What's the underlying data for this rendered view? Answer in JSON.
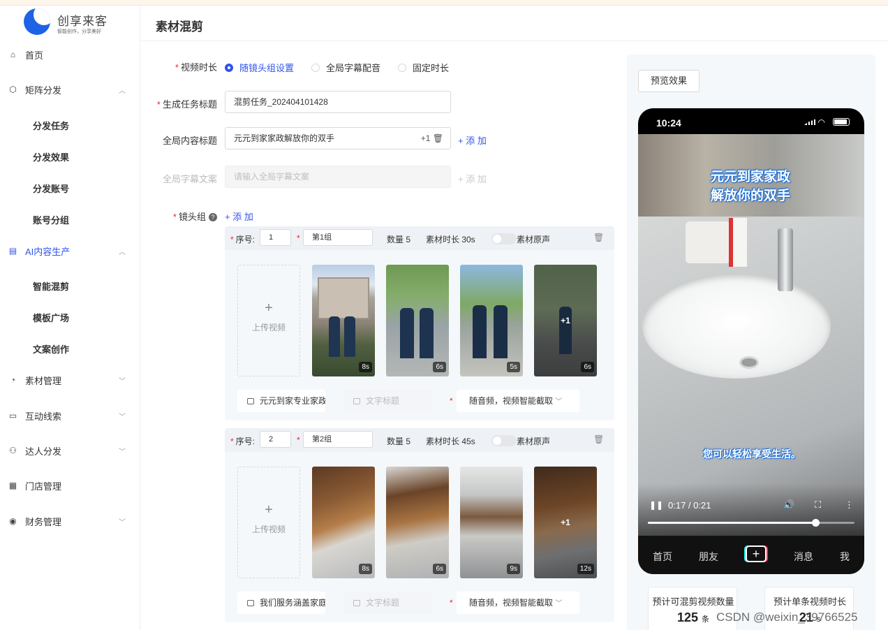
{
  "app": {
    "name": "创享来客",
    "slogan": "智能创作，分享美好"
  },
  "sidebar": {
    "items": [
      {
        "label": "首页",
        "icon": "home-icon"
      },
      {
        "label": "矩阵分发",
        "icon": "cube-icon",
        "expanded": true,
        "children": [
          "分发任务",
          "分发效果",
          "分发账号",
          "账号分组"
        ]
      },
      {
        "label": "AI内容生产",
        "icon": "document-icon",
        "expanded": true,
        "active": true,
        "children": [
          "智能混剪",
          "模板广场",
          "文案创作"
        ]
      },
      {
        "label": "素材管理",
        "icon": "circle-icon"
      },
      {
        "label": "互动线索",
        "icon": "chat-icon"
      },
      {
        "label": "达人分发",
        "icon": "people-icon"
      },
      {
        "label": "门店管理",
        "icon": "store-icon"
      },
      {
        "label": "财务管理",
        "icon": "finance-icon"
      }
    ]
  },
  "page": {
    "title": "素材混剪"
  },
  "form": {
    "duration": {
      "label": "视频时长",
      "options": [
        "随镜头组设置",
        "全局字幕配音",
        "固定时长"
      ],
      "selected": "随镜头组设置"
    },
    "task_title": {
      "label": "生成任务标题",
      "value": "混剪任务_202404101428"
    },
    "content_title": {
      "label": "全局内容标题",
      "value": "元元到家家政解放你的双手",
      "count": "+1",
      "add": "+ 添 加"
    },
    "subtitle_copy": {
      "label": "全局字幕文案",
      "placeholder": "请输入全局字幕文案",
      "add": "+ 添 加"
    },
    "shot_groups": {
      "label": "镜头组",
      "add": "+ 添 加"
    }
  },
  "groups": [
    {
      "seq_label": "序号:",
      "seq": "1",
      "name": "第1组",
      "count": "数量 5",
      "material_duration": "素材时长 30s",
      "original_audio": "素材原声",
      "upload": "上传视频",
      "thumbs": [
        {
          "dur": "8s"
        },
        {
          "dur": "6s"
        },
        {
          "dur": "5s"
        },
        {
          "dur": "6s",
          "more": "+1"
        }
      ],
      "text": "元元到家专业家政",
      "text_title_placeholder": "文字标题",
      "audio_mode": "随音频，视频智能截取"
    },
    {
      "seq_label": "序号:",
      "seq": "2",
      "name": "第2组",
      "count": "数量 5",
      "material_duration": "素材时长 45s",
      "original_audio": "素材原声",
      "upload": "上传视频",
      "thumbs": [
        {
          "dur": "8s"
        },
        {
          "dur": "6s"
        },
        {
          "dur": "9s"
        },
        {
          "dur": "12s",
          "more": "+1"
        }
      ],
      "text": "我们服务涵盖家庭保洁",
      "text_title_placeholder": "文字标题",
      "audio_mode": "随音频，视频智能截取"
    }
  ],
  "preview": {
    "button": "预览效果",
    "status_time": "10:24",
    "caption_top": "元元到家家政解放你的双手",
    "caption_bottom": "您可以轻松享受生活。",
    "player_time": "0:17 / 0:21",
    "progress": 0.81,
    "tabs": [
      "首页",
      "朋友",
      "+",
      "消息",
      "我"
    ]
  },
  "stats": [
    {
      "title": "预计可混剪视频数量",
      "value": "125",
      "unit": "条"
    },
    {
      "title": "预计单条视频时长",
      "value": "21",
      "unit": "s"
    }
  ],
  "watermark": "CSDN @weixin_39766525",
  "colors": {
    "accent": "#2f54eb",
    "required": "#f5222d"
  }
}
